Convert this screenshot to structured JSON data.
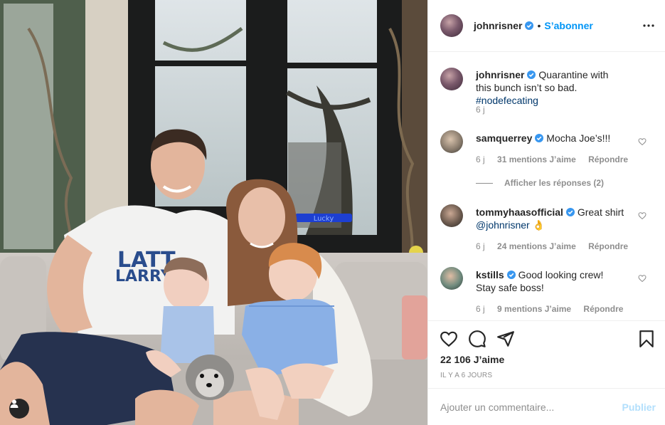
{
  "post": {
    "username": "johnrisner",
    "follow_label": "S’abonner",
    "caption": "Quarantine with this bunch isn’t so bad.",
    "hashtag": "#nodefecating",
    "caption_time": "6 j",
    "likes": "22 106 J’aime",
    "posted_ago": "IL Y A 6 JOURS",
    "shirt_text_1": "LATT",
    "shirt_text_2": "LARRY",
    "sign_text": "Lucky"
  },
  "comments": [
    {
      "username": "samquerrey",
      "text": "Mocha Joe’s!!!",
      "time": "6 j",
      "likes": "31 mentions J’aime",
      "reply": "Répondre"
    },
    {
      "username": "tommyhaasofficial",
      "text": "Great shirt",
      "mention": "@johnrisner",
      "emoji": "👌",
      "time": "6 j",
      "likes": "24 mentions J’aime",
      "reply": "Répondre"
    },
    {
      "username": "kstills",
      "text": "Good looking crew! Stay safe boss!",
      "time": "6 j",
      "likes": "9 mentions J’aime",
      "reply": "Répondre"
    }
  ],
  "view_replies": "Afficher les réponses (2)",
  "add_comment": {
    "placeholder": "Ajouter un commentaire...",
    "publish_label": "Publier"
  },
  "colors": {
    "accent": "#0095f6",
    "verified": "#3897f0",
    "publish_disabled": "#b2dffc"
  }
}
